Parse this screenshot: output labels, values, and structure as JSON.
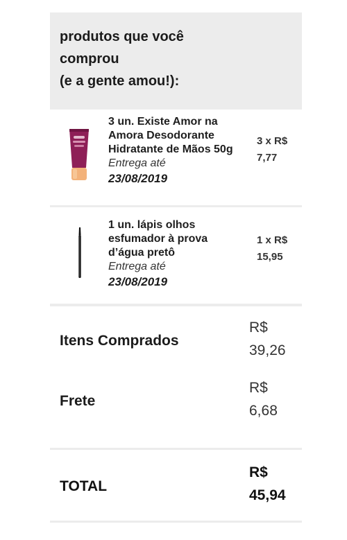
{
  "header": {
    "title": "produtos que você\ncomprou\n(e a gente amou!):"
  },
  "items": [
    {
      "description": "3 un. Existe Amor na Amora Desodorante Hidratante de Mãos 50g",
      "delivery_label": "Entrega até",
      "delivery_date": "23/08/2019",
      "qty_price_line1": "3 x R$",
      "qty_price_line2": "7,77",
      "image": "hand-cream-tube-icon"
    },
    {
      "description": "1 un. lápis olhos esfumador à prova d’água pretô",
      "delivery_label": "Entrega até",
      "delivery_date": "23/08/2019",
      "qty_price_line1": "1 x R$",
      "qty_price_line2": "15,95",
      "image": "eyeliner-pencil-icon"
    }
  ],
  "totals": {
    "items_label": "Itens Comprados",
    "items_currency": "R$",
    "items_value": "39,26",
    "shipping_label": "Frete",
    "shipping_currency": "R$",
    "shipping_value": "6,68"
  },
  "grand_total": {
    "label": "TOTAL",
    "currency": "R$",
    "value": "45,94"
  },
  "colors": {
    "header_bg": "#ececec",
    "tube": "#8e1f57",
    "tube_cap": "#f3b27a"
  }
}
